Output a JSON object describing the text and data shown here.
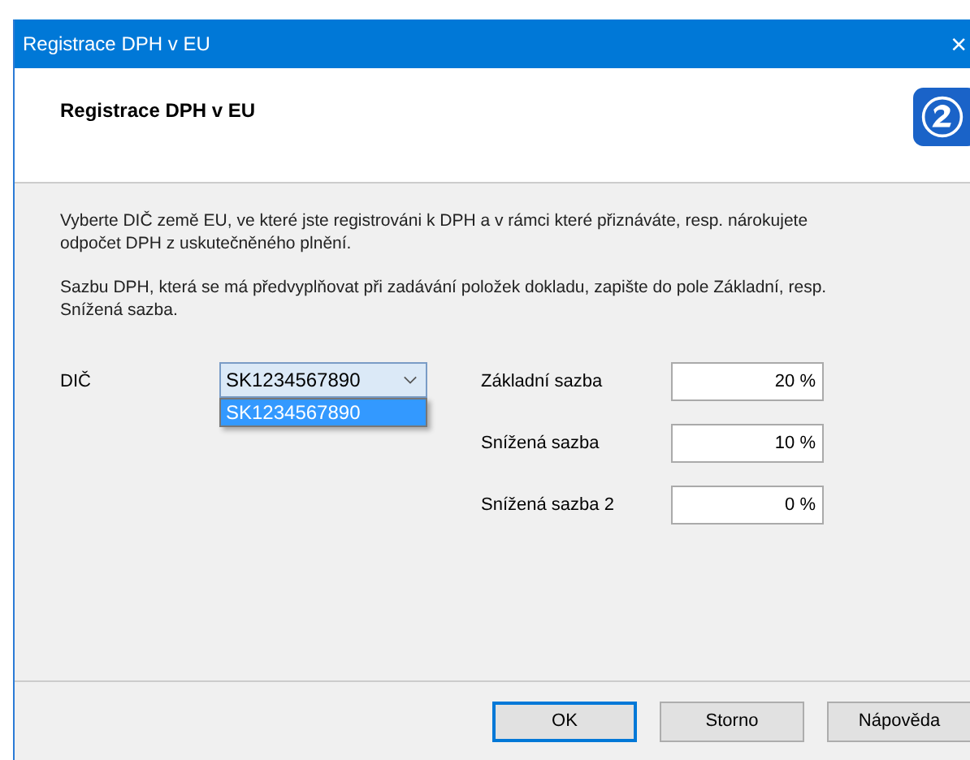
{
  "window": {
    "title": "Registrace DPH v EU",
    "close": "×"
  },
  "header": {
    "title": "Registrace DPH v EU"
  },
  "paragraphs": [
    "Vyberte DIČ země EU, ve které jste registrováni k DPH a v rámci které přiznáváte, resp. nárokujete odpočet DPH z uskutečněného plnění.",
    "Sazbu DPH, která se má předvyplňovat při zadávání položek dokladu, zapište do pole Základní, resp. Snížená sazba."
  ],
  "dic": {
    "label": "DIČ",
    "value": "SK1234567890",
    "expanded": true,
    "options": [
      {
        "label": "SK1234567890",
        "selected": true
      }
    ]
  },
  "rates": [
    {
      "label": "Základní sazba",
      "value": "20 %"
    },
    {
      "label": "Snížená sazba",
      "value": "10 %"
    },
    {
      "label": "Snížená sazba 2",
      "value": "0 %"
    }
  ],
  "buttons": [
    {
      "label": "OK",
      "default": true
    },
    {
      "label": "Storno",
      "default": false
    },
    {
      "label": "Nápověda",
      "default": false
    }
  ]
}
